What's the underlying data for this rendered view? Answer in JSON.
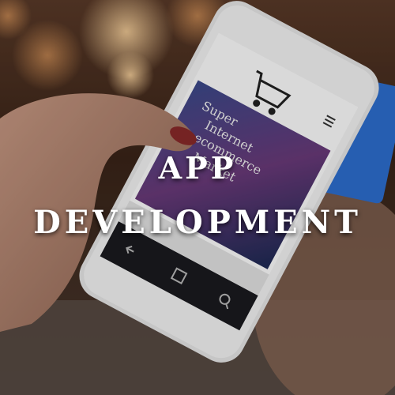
{
  "headline": {
    "line1": "APP",
    "line2": "DEVELOPMENT"
  },
  "phone_screen": {
    "cart_icon": "shopping-cart-icon",
    "menu_icon": "hamburger-menu-icon",
    "banner_text_1": "Super",
    "banner_text_2": "Internet",
    "banner_text_3": "ecommerce",
    "banner_text_4": "Market",
    "nav_icons": [
      "back-icon",
      "home-icon",
      "search-icon"
    ]
  },
  "colors": {
    "overlay_text": "#ffffff",
    "phone_body": "#f2f2f2",
    "screen_dark": "#1a1a1f",
    "card": "#2d6fd1"
  }
}
